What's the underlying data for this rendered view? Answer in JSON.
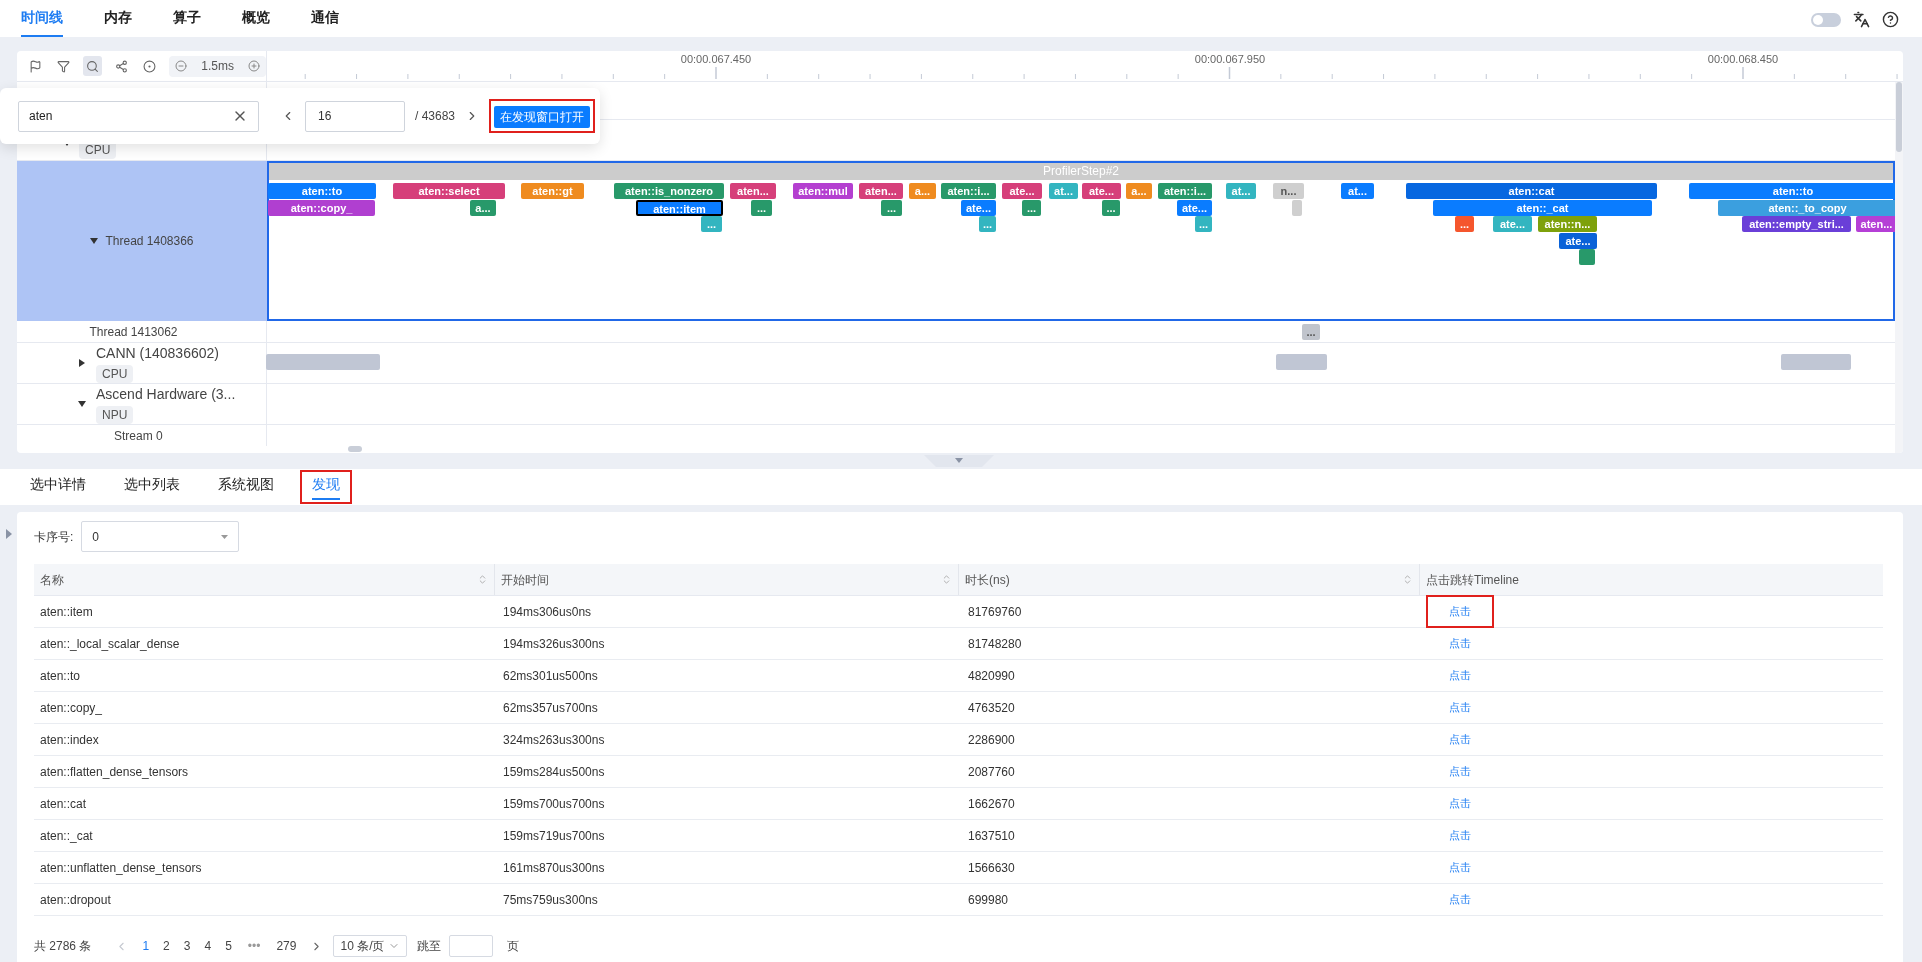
{
  "nav": {
    "tabs": [
      {
        "label": "时间线",
        "selected": true
      },
      {
        "label": "内存",
        "selected": false
      },
      {
        "label": "算子",
        "selected": false
      },
      {
        "label": "概览",
        "selected": false
      },
      {
        "label": "通信",
        "selected": false
      }
    ],
    "theme_switch": {
      "on": false
    }
  },
  "timeline": {
    "toolbar": {
      "tools": [
        {
          "kind": "flag",
          "selected": false
        },
        {
          "kind": "filter",
          "selected": false
        },
        {
          "kind": "search",
          "selected": true
        },
        {
          "kind": "link",
          "selected": false
        },
        {
          "kind": "target",
          "selected": false
        }
      ],
      "zoom_value": "1.5ms"
    },
    "ruler": {
      "labels": [
        "00:00.067.450",
        "00:00.067.950",
        "00:00.068.450"
      ]
    },
    "search": {
      "value": "aten",
      "index": "16",
      "total": "/ 43683",
      "open_button": {
        "label": "在发现窗口打开",
        "highlighted": true
      }
    },
    "tracks": [
      {
        "tag": "CPU",
        "expanded": true,
        "children": [
          {
            "name": "Thread 1408366",
            "expanded": true,
            "selected": true,
            "step": "ProfilerStep#2",
            "blocks": [
              {
                "label": "aten::to",
                "color": "#0a7cff",
                "selected": false
              },
              {
                "label": "aten::select",
                "color": "#d63f7a",
                "selected": false
              },
              {
                "label": "aten::gt",
                "color": "#ef8b1f",
                "selected": false
              },
              {
                "label": "aten::is_nonzero",
                "color": "#28996a",
                "selected": false
              },
              {
                "label": "aten...",
                "color": "#d63f7a",
                "selected": false
              },
              {
                "label": "aten::mul",
                "color": "#b43fd0",
                "selected": false
              },
              {
                "label": "aten...",
                "color": "#d63f7a",
                "selected": false
              },
              {
                "label": "a...",
                "color": "#ef8b1f",
                "selected": false
              },
              {
                "label": "aten::i...",
                "color": "#28996a",
                "selected": false
              },
              {
                "label": "ate...",
                "color": "#d63f7a",
                "selected": false
              },
              {
                "label": "at...",
                "color": "#33b5c0",
                "selected": false
              },
              {
                "label": "ate...",
                "color": "#d63f7a",
                "selected": false
              },
              {
                "label": "a...",
                "color": "#ef8b1f",
                "selected": false
              },
              {
                "label": "aten::i...",
                "color": "#28996a",
                "selected": false
              },
              {
                "label": "at...",
                "color": "#33b5c0",
                "selected": false
              },
              {
                "label": "n...",
                "color": "#cfcfcf",
                "selected": false
              },
              {
                "label": "at...",
                "color": "#0a7cff",
                "selected": false
              },
              {
                "label": "aten::cat",
                "color": "#0767e0",
                "selected": false
              },
              {
                "label": "aten::to",
                "color": "#0a7cff",
                "selected": false
              },
              {
                "label": "aten::copy_",
                "color": "#b03fd0",
                "selected": false
              },
              {
                "label": "a...",
                "color": "#28996a",
                "selected": false
              },
              {
                "label": "aten::item",
                "color": "#0a7cff",
                "selected": true
              },
              {
                "label": "...",
                "color": "#28996a",
                "selected": false
              },
              {
                "label": "...",
                "color": "#28996a",
                "selected": false
              },
              {
                "label": "ate...",
                "color": "#0a7cff",
                "selected": false
              },
              {
                "label": "...",
                "color": "#28996a",
                "selected": false
              },
              {
                "label": "...",
                "color": "#28996a",
                "selected": false
              },
              {
                "label": "ate...",
                "color": "#0a7cff",
                "selected": false
              },
              {
                "color": "#cfcfcf",
                "selected": false
              },
              {
                "label": "aten::_cat",
                "color": "#0a7cff",
                "selected": false
              },
              {
                "label": "aten::_to_copy",
                "color": "#3b9fdf",
                "selected": false
              },
              {
                "label": "...",
                "color": "#33b5c0",
                "selected": false
              },
              {
                "label": "...",
                "color": "#33b5c0",
                "selected": false
              },
              {
                "label": "...",
                "color": "#33b5c0",
                "selected": false
              },
              {
                "label": "...",
                "color": "#f5562d",
                "selected": false
              },
              {
                "label": "ate...",
                "color": "#33b5c0",
                "selected": false
              },
              {
                "label": "aten::n...",
                "color": "#7ea10b",
                "selected": false
              },
              {
                "label": "aten::empty_stri...",
                "color": "#6a3fd8",
                "selected": false
              },
              {
                "label": "aten...",
                "color": "#b53fd6",
                "selected": false
              },
              {
                "label": "ate...",
                "color": "#0a62d8",
                "selected": false
              },
              {
                "color": "#28996a",
                "selected": false
              }
            ]
          },
          {
            "name": "Thread 1413062",
            "selected": false,
            "blocks": [
              {
                "label": "...",
                "color": "#c0c4cc",
                "selected": false
              }
            ]
          }
        ]
      },
      {
        "name": "CANN (140836602)",
        "tag": "CPU",
        "expanded": false,
        "blocks": [
          {
            "color": "#c0c6d4",
            "selected": false
          },
          {
            "color": "#c0c6d4",
            "selected": false
          },
          {
            "color": "#c0c6d4",
            "selected": false
          }
        ]
      },
      {
        "name": "Ascend Hardware (3...",
        "tag": "NPU",
        "expanded": true,
        "children": [
          {
            "name": "Stream 0",
            "selected": false
          }
        ]
      }
    ]
  },
  "bottom_tabs": [
    {
      "label": "选中详情",
      "selected": false,
      "highlighted": false
    },
    {
      "label": "选中列表",
      "selected": false,
      "highlighted": false
    },
    {
      "label": "系统视图",
      "selected": false,
      "highlighted": false
    },
    {
      "label": "发现",
      "selected": true,
      "highlighted": true
    }
  ],
  "discover": {
    "card_label": "卡序号:",
    "card_value": "0",
    "columns": [
      {
        "label": "名称",
        "sortable": true
      },
      {
        "label": "开始时间",
        "sortable": true
      },
      {
        "label": "时长(ns)",
        "sortable": true
      },
      {
        "label": "点击跳转Timeline",
        "sortable": false
      }
    ],
    "rows": [
      {
        "name": "aten::item",
        "start": "194ms306us0ns",
        "duration": "81769760",
        "link": "点击",
        "highlighted": true
      },
      {
        "name": "aten::_local_scalar_dense",
        "start": "194ms326us300ns",
        "duration": "81748280",
        "link": "点击",
        "highlighted": false
      },
      {
        "name": "aten::to",
        "start": "62ms301us500ns",
        "duration": "4820990",
        "link": "点击",
        "highlighted": false
      },
      {
        "name": "aten::copy_",
        "start": "62ms357us700ns",
        "duration": "4763520",
        "link": "点击",
        "highlighted": false
      },
      {
        "name": "aten::index",
        "start": "324ms263us300ns",
        "duration": "2286900",
        "link": "点击",
        "highlighted": false
      },
      {
        "name": "aten::flatten_dense_tensors",
        "start": "159ms284us500ns",
        "duration": "2087760",
        "link": "点击",
        "highlighted": false
      },
      {
        "name": "aten::cat",
        "start": "159ms700us700ns",
        "duration": "1662670",
        "link": "点击",
        "highlighted": false
      },
      {
        "name": "aten::_cat",
        "start": "159ms719us700ns",
        "duration": "1637510",
        "link": "点击",
        "highlighted": false
      },
      {
        "name": "aten::unflatten_dense_tensors",
        "start": "161ms870us300ns",
        "duration": "1566630",
        "link": "点击",
        "highlighted": false
      },
      {
        "name": "aten::dropout",
        "start": "75ms759us300ns",
        "duration": "699980",
        "link": "点击",
        "highlighted": false
      }
    ],
    "pagination": {
      "total": "共 2786 条",
      "prev_disabled": true,
      "pages": [
        {
          "label": "1",
          "selected": true
        },
        {
          "label": "2",
          "selected": false
        },
        {
          "label": "3",
          "selected": false
        },
        {
          "label": "4",
          "selected": false
        },
        {
          "label": "5",
          "selected": false
        },
        {
          "label": "279",
          "selected": false
        }
      ],
      "ellipsis": "•••",
      "page_size": "10 条/页",
      "jump_label": "跳至",
      "jump_suffix": "页"
    }
  }
}
